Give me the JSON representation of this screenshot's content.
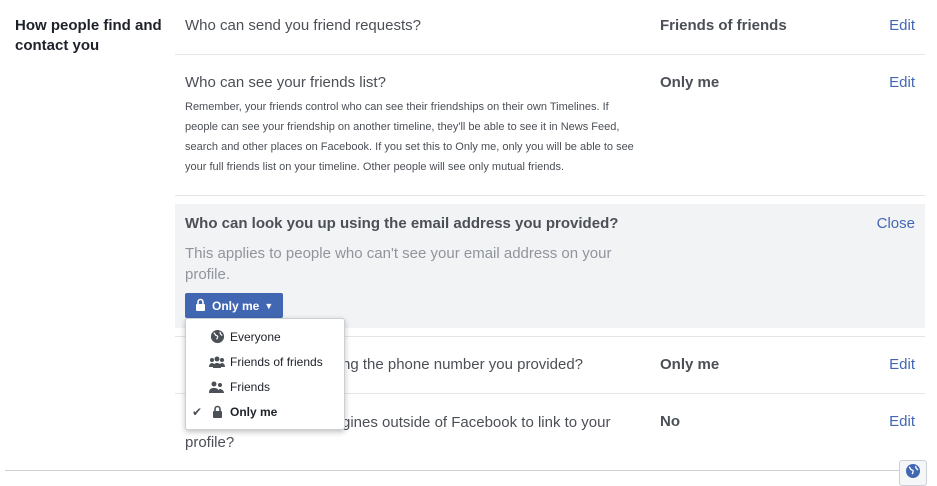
{
  "section": {
    "title": "How people find and contact you"
  },
  "rows": [
    {
      "question": "Who can send you friend requests?",
      "value": "Friends of friends",
      "action": "Edit"
    },
    {
      "question": "Who can see your friends list?",
      "value": "Only me",
      "action": "Edit",
      "description": "Remember, your friends control who can see their friendships on their own Timelines. If people can see your friendship on another timeline, they'll be able to see it in News Feed, search and other places on Facebook. If you set this to Only me, only you will be able to see your full friends list on your timeline. Other people will see only mutual friends."
    },
    {
      "question": "Who can look you up using the phone number you provided?",
      "question_visible": "ng the phone number you provided?",
      "value": "Only me",
      "action": "Edit"
    },
    {
      "question_visible": "gines outside of Facebook to link to your profile?",
      "value": "No",
      "action": "Edit"
    }
  ],
  "expanded": {
    "question": "Who can look you up using the email address you provided?",
    "description": "This applies to people who can't see your email address on your profile.",
    "close_label": "Close",
    "selected_label": "Only me"
  },
  "dropdown": {
    "items": [
      {
        "label": "Everyone",
        "icon": "globe-icon",
        "selected": false
      },
      {
        "label": "Friends of friends",
        "icon": "friends-of-friends-icon",
        "selected": false
      },
      {
        "label": "Friends",
        "icon": "friends-icon",
        "selected": false
      },
      {
        "label": "Only me",
        "icon": "lock-icon",
        "selected": true
      }
    ]
  },
  "footer": {
    "icon": "globe-icon"
  },
  "colors": {
    "link": "#4267b2",
    "button": "#4267b2",
    "expanded_bg": "#f2f3f5"
  }
}
